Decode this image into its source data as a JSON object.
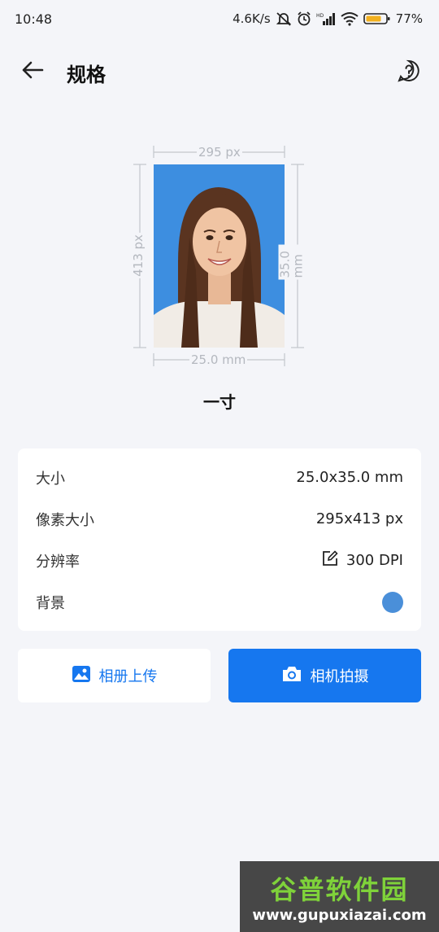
{
  "status_bar": {
    "time": "10:48",
    "net_speed": "4.6K/s",
    "battery": "77%",
    "icons": [
      "mute-bell-icon",
      "alarm-icon",
      "hd-signal-icon",
      "wifi-icon",
      "battery-icon"
    ]
  },
  "header": {
    "title": "规格",
    "back_icon": "arrow-left-icon",
    "help_icon": "help-circle-icon"
  },
  "preview": {
    "width_px_label": "295 px",
    "height_px_label": "413 px",
    "width_mm_label": "25.0 mm",
    "height_mm_label": "35.0 mm",
    "background_color": "#3d8ee0",
    "spec_name": "一寸"
  },
  "info": {
    "rows": [
      {
        "label": "大小",
        "value": "25.0x35.0 mm"
      },
      {
        "label": "像素大小",
        "value": "295x413 px"
      },
      {
        "label": "分辨率",
        "value": "300 DPI",
        "icon": "edit-icon"
      },
      {
        "label": "背景",
        "color": "#4a8fd9"
      }
    ]
  },
  "actions": {
    "upload_label": "相册上传",
    "upload_icon": "image-icon",
    "camera_label": "相机拍摄",
    "camera_icon": "camera-icon"
  },
  "watermark": {
    "title": "谷普软件园",
    "url": "www.gupuxiazai.com"
  },
  "colors": {
    "accent": "#1677ef",
    "page_bg": "#f4f5f9"
  }
}
